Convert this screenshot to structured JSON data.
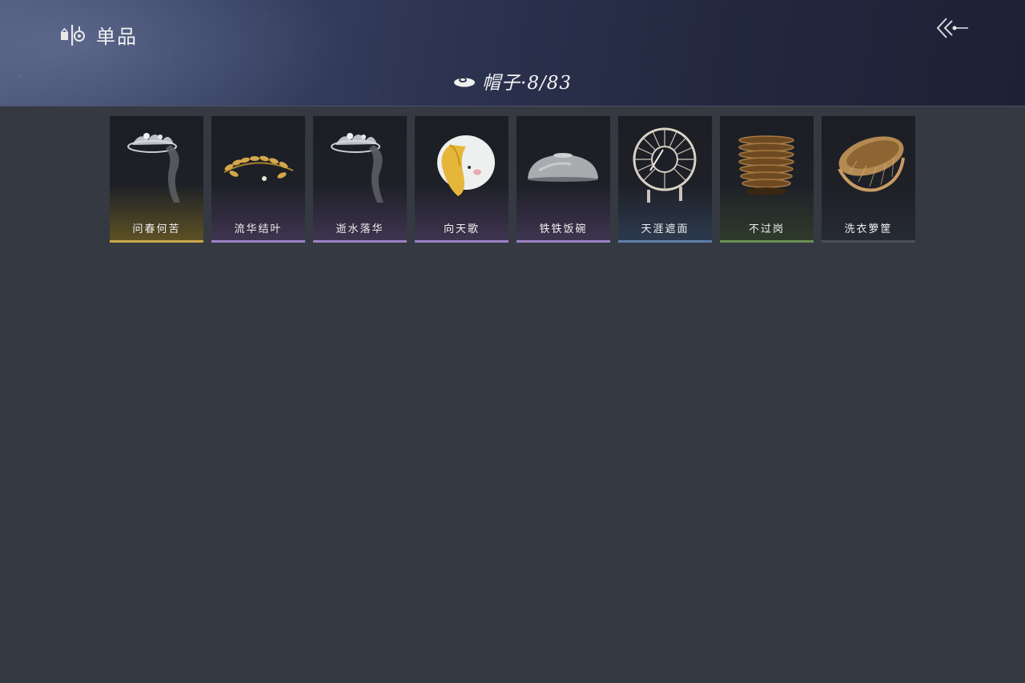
{
  "header": {
    "title": "单品",
    "category_label": "帽子·8/83"
  },
  "items": [
    {
      "name": "问春何苦",
      "icon": "veiled-crown-icon",
      "tint": "#5c5124",
      "edge": "#c9a94a"
    },
    {
      "name": "流华结叶",
      "icon": "golden-laurel-icon",
      "tint": "#3e3450",
      "edge": "#9b82c4"
    },
    {
      "name": "逝水落华",
      "icon": "veiled-crown-icon",
      "tint": "#3e3450",
      "edge": "#9b82c4"
    },
    {
      "name": "向天歌",
      "icon": "duck-hat-icon",
      "tint": "#3e3450",
      "edge": "#9b82c4"
    },
    {
      "name": "铁铁饭碗",
      "icon": "metal-bowl-icon",
      "tint": "#3e3450",
      "edge": "#9b82c4"
    },
    {
      "name": "天涯遮面",
      "icon": "woven-sunhat-icon",
      "tint": "#2c3a4e",
      "edge": "#5f7fa8"
    },
    {
      "name": "不过岗",
      "icon": "stacked-bowls-icon",
      "tint": "#2f3b2c",
      "edge": "#6b8f55"
    },
    {
      "name": "洗衣箩筐",
      "icon": "wicker-basket-icon",
      "tint": "#262a33",
      "edge": "#4a4f5c"
    }
  ]
}
